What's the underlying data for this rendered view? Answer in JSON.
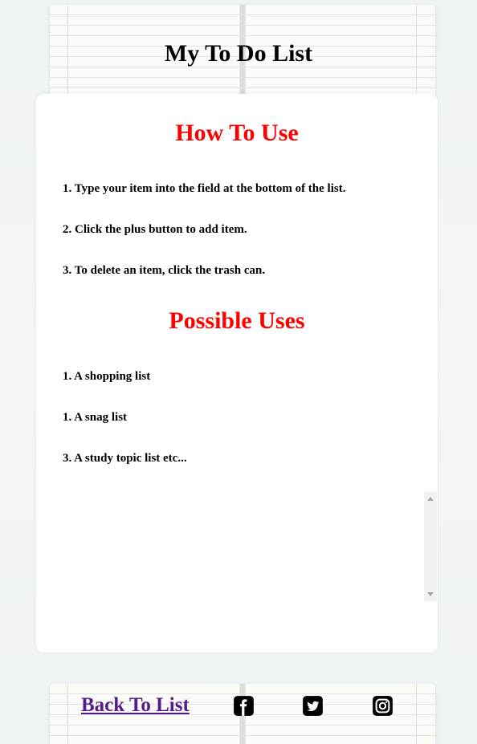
{
  "header": {
    "title": "My To Do List"
  },
  "how_to_use": {
    "heading": "How To Use",
    "items": [
      "1. Type your item into the field at the bottom of the list.",
      "2. Click the plus button to add item.",
      "3. To delete an item, click the trash can."
    ]
  },
  "possible_uses": {
    "heading": "Possible Uses",
    "items": [
      "1. A shopping list",
      "1. A snag list",
      "3. A study topic list etc..."
    ]
  },
  "footer": {
    "back_link": "Back To List",
    "icons": [
      "facebook-icon",
      "twitter-icon",
      "instagram-icon"
    ]
  },
  "colors": {
    "heading_red": "#ff0000",
    "link_purple": "#551a8b",
    "card_bg": "#ffffff"
  }
}
